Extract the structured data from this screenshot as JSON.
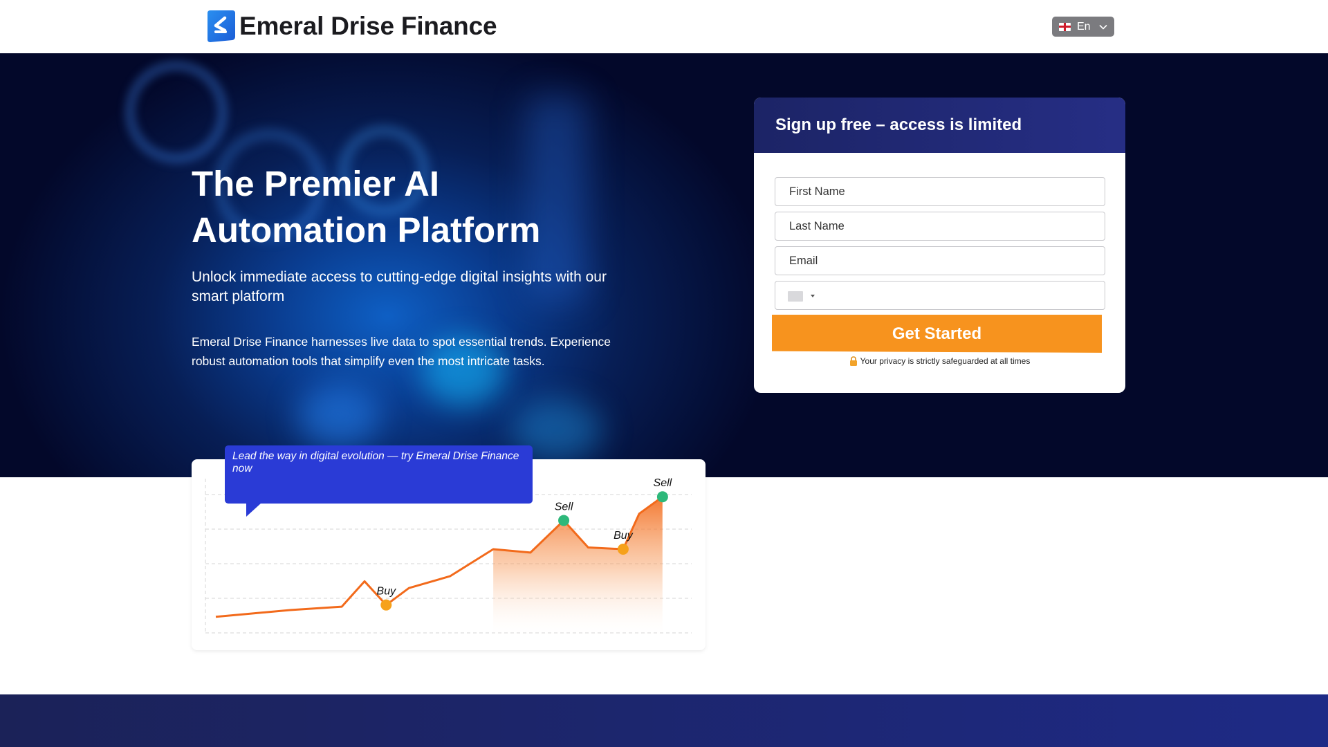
{
  "header": {
    "brand_name": "Emeral Drise Finance",
    "logo_icon": "chevron-left-logo-icon",
    "language": {
      "label": "En",
      "flag_icon": "england-flag-icon",
      "chevron_icon": "chevron-down-icon"
    }
  },
  "hero": {
    "title": "The Premier AI Automation Platform",
    "subtitle": "Unlock immediate access to cutting-edge digital insights with our smart platform",
    "body": "Emeral Drise Finance harnesses live data to spot essential trends. Experience robust automation tools that simplify even the most intricate tasks."
  },
  "signup": {
    "heading": "Sign up free – access is limited",
    "first_name_placeholder": "First Name",
    "last_name_placeholder": "Last Name",
    "email_placeholder": "Email",
    "phone_placeholder": "",
    "submit_label": "Get Started",
    "privacy_text": "Your privacy is strictly safeguarded at all times",
    "privacy_icon": "lock-icon"
  },
  "chart_bubble": {
    "text": "Lead the way in digital evolution — try Emeral Drise Finance now"
  },
  "chart_data": {
    "type": "area",
    "x": [
      0,
      1,
      2,
      3,
      4,
      5,
      6,
      7,
      8,
      9,
      10,
      11,
      12,
      13
    ],
    "y": [
      0.5,
      0.9,
      1.1,
      2.6,
      1.2,
      2.2,
      2.9,
      4.5,
      4.3,
      6.2,
      4.6,
      4.5,
      6.6,
      7.6
    ],
    "annotations": [
      {
        "index": 4,
        "label": "Buy",
        "kind": "buy"
      },
      {
        "index": 9,
        "label": "Sell",
        "kind": "sell"
      },
      {
        "index": 11,
        "label": "Buy",
        "kind": "buy"
      },
      {
        "index": 13,
        "label": "Sell",
        "kind": "sell"
      }
    ],
    "ylim": [
      0,
      9
    ],
    "grid": true,
    "colors": {
      "line": "#f26a1b",
      "buy": "#f6a11a",
      "sell": "#2db87a"
    }
  }
}
